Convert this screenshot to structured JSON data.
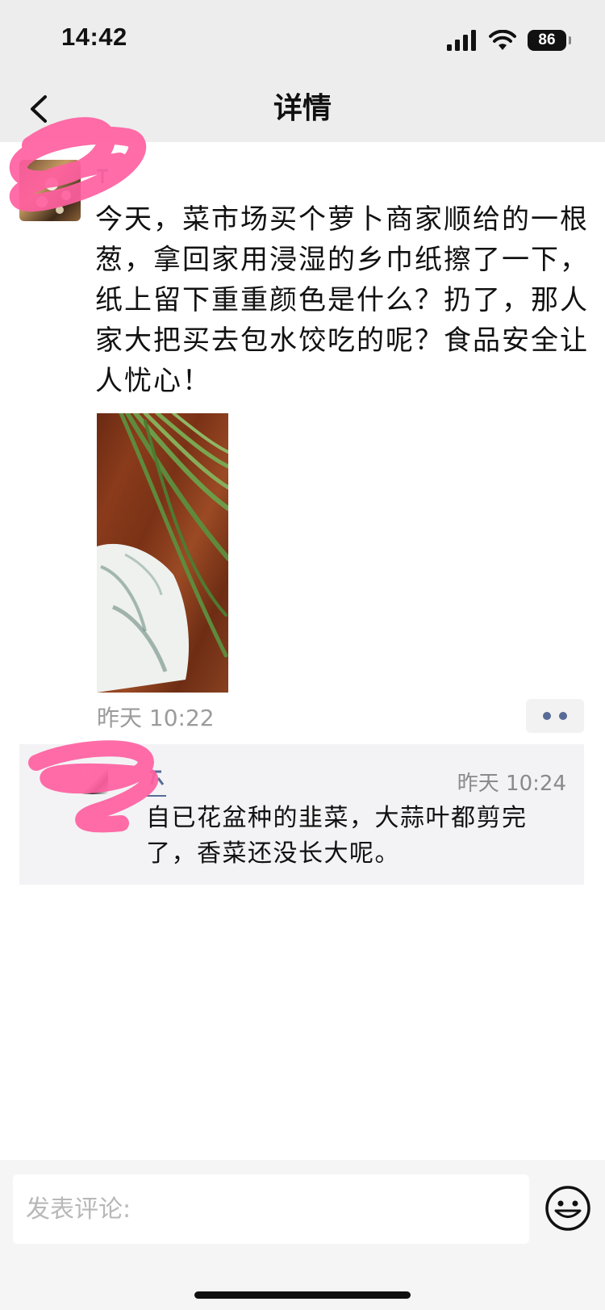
{
  "status_bar": {
    "time": "14:42",
    "battery": "86",
    "icons": [
      "signal-icon",
      "wifi-icon",
      "battery-icon"
    ]
  },
  "nav": {
    "title": "详情",
    "back_icon": "chevron-left-icon"
  },
  "post": {
    "text": "今天，菜市场买个萝卜商家顺给的一根葱，拿回家用浸湿的乡巾纸擦了一下，纸上留下重重颜色是什么？扔了，那人家大把买去包水饺吃的呢？食品安全让人忧心！",
    "time": "昨天 10:22",
    "more_icon": "more-dots-icon"
  },
  "comment": {
    "time": "昨天 10:24",
    "text": "自已花盆种的韭菜，大蒜叶都剪完了，香菜还没长大呢。"
  },
  "bottom_bar": {
    "input_placeholder": "发表评论:",
    "emoji_icon": "smiley-icon"
  },
  "colors": {
    "link": "#576b95",
    "scribble": "#ff5fa0",
    "bar_background": "#ededed"
  }
}
